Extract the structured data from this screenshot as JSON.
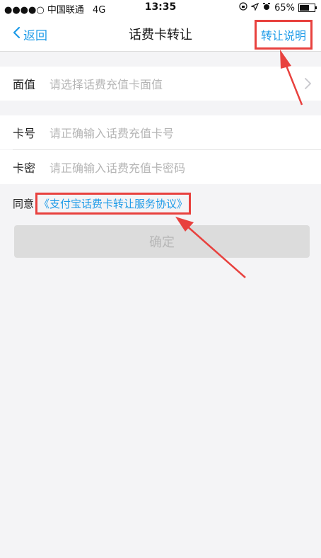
{
  "status_bar": {
    "carrier": "●●●●○ 中国联通",
    "network": "4G",
    "time": "13:35",
    "battery_percent": "65%",
    "battery_level": 0.65
  },
  "nav": {
    "back_label": "返回",
    "title": "话费卡转让",
    "right_label": "转让说明"
  },
  "form": {
    "denomination_label": "面值",
    "denomination_placeholder": "请选择话费充值卡面值",
    "card_number_label": "卡号",
    "card_number_placeholder": "请正确输入话费充值卡号",
    "card_password_label": "卡密",
    "card_password_placeholder": "请正确输入话费充值卡密码"
  },
  "agreement": {
    "prefix": "同意",
    "link_text": "《支付宝话费卡转让服务协议》"
  },
  "confirm_label": "确定",
  "colors": {
    "accent": "#1e9be8",
    "highlight": "#e8413e",
    "background": "#f4f4f6"
  }
}
